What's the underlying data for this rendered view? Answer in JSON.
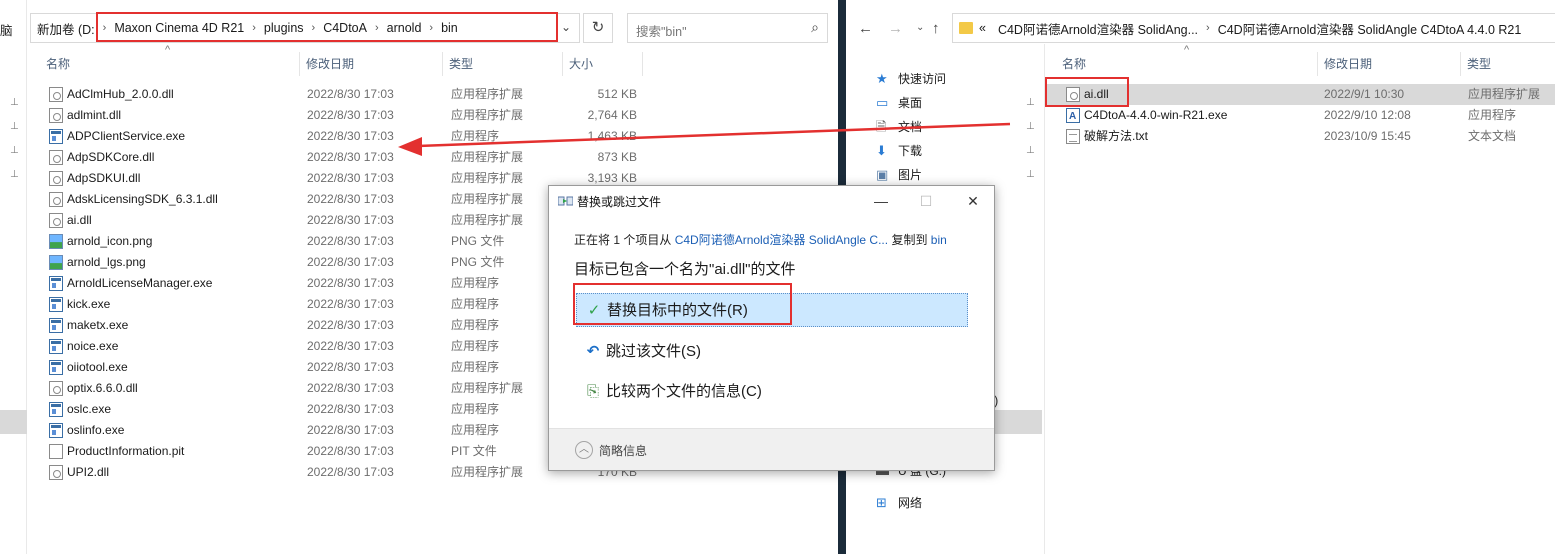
{
  "left": {
    "breadcrumb_prefix": "脑",
    "breadcrumb": [
      "新加卷 (D:",
      "Maxon Cinema 4D R21",
      "plugins",
      "C4DtoA",
      "arnold",
      "bin"
    ],
    "search_placeholder": "搜索\"bin\"",
    "columns": {
      "name": "名称",
      "date": "修改日期",
      "type": "类型",
      "size": "大小"
    },
    "files": [
      {
        "name": "AdClmHub_2.0.0.dll",
        "date": "2022/8/30 17:03",
        "type": "应用程序扩展",
        "size": "512 KB",
        "icon": "dll"
      },
      {
        "name": "adlmint.dll",
        "date": "2022/8/30 17:03",
        "type": "应用程序扩展",
        "size": "2,764 KB",
        "icon": "dll"
      },
      {
        "name": "ADPClientService.exe",
        "date": "2022/8/30 17:03",
        "type": "应用程序",
        "size": "1,463 KB",
        "icon": "exe"
      },
      {
        "name": "AdpSDKCore.dll",
        "date": "2022/8/30 17:03",
        "type": "应用程序扩展",
        "size": "873 KB",
        "icon": "dll"
      },
      {
        "name": "AdpSDKUI.dll",
        "date": "2022/8/30 17:03",
        "type": "应用程序扩展",
        "size": "3,193 KB",
        "icon": "dll"
      },
      {
        "name": "AdskLicensingSDK_6.3.1.dll",
        "date": "2022/8/30 17:03",
        "type": "应用程序扩展",
        "size": "",
        "icon": "dll"
      },
      {
        "name": "ai.dll",
        "date": "2022/8/30 17:03",
        "type": "应用程序扩展",
        "size": "",
        "icon": "dll"
      },
      {
        "name": "arnold_icon.png",
        "date": "2022/8/30 17:03",
        "type": "PNG 文件",
        "size": "",
        "icon": "png"
      },
      {
        "name": "arnold_lgs.png",
        "date": "2022/8/30 17:03",
        "type": "PNG 文件",
        "size": "",
        "icon": "png"
      },
      {
        "name": "ArnoldLicenseManager.exe",
        "date": "2022/8/30 17:03",
        "type": "应用程序",
        "size": "",
        "icon": "exe"
      },
      {
        "name": "kick.exe",
        "date": "2022/8/30 17:03",
        "type": "应用程序",
        "size": "",
        "icon": "exe"
      },
      {
        "name": "maketx.exe",
        "date": "2022/8/30 17:03",
        "type": "应用程序",
        "size": "",
        "icon": "exe"
      },
      {
        "name": "noice.exe",
        "date": "2022/8/30 17:03",
        "type": "应用程序",
        "size": "",
        "icon": "exe"
      },
      {
        "name": "oiiotool.exe",
        "date": "2022/8/30 17:03",
        "type": "应用程序",
        "size": "",
        "icon": "exe"
      },
      {
        "name": "optix.6.6.0.dll",
        "date": "2022/8/30 17:03",
        "type": "应用程序扩展",
        "size": "",
        "icon": "dll"
      },
      {
        "name": "oslc.exe",
        "date": "2022/8/30 17:03",
        "type": "应用程序",
        "size": "",
        "icon": "exe"
      },
      {
        "name": "oslinfo.exe",
        "date": "2022/8/30 17:03",
        "type": "应用程序",
        "size": "",
        "icon": "exe"
      },
      {
        "name": "ProductInformation.pit",
        "date": "2022/8/30 17:03",
        "type": "PIT 文件",
        "size": "",
        "icon": "pit"
      },
      {
        "name": "UPI2.dll",
        "date": "2022/8/30 17:03",
        "type": "应用程序扩展",
        "size": "170 KB",
        "icon": "dll"
      }
    ]
  },
  "right": {
    "breadcrumb_prefix": "«",
    "breadcrumb": [
      "C4D阿诺德Arnold渲染器 SolidAng...",
      "C4D阿诺德Arnold渲染器 SolidAngle C4DtoA 4.4.0 R21"
    ],
    "columns": {
      "name": "名称",
      "date": "修改日期",
      "type": "类型"
    },
    "nav": [
      {
        "label": "快速访问",
        "icon": "star-icon"
      },
      {
        "label": "桌面",
        "icon": "desktop-icon"
      },
      {
        "label": "文档",
        "icon": "document-icon"
      },
      {
        "label": "下载",
        "icon": "download-icon"
      },
      {
        "label": "图片",
        "icon": "pictures-icon"
      }
    ],
    "nav_bottom": [
      {
        "label": "U 盘 (G:)",
        "icon": "usb-drive-icon"
      },
      {
        "label": "网络",
        "icon": "network-icon"
      }
    ],
    "files": [
      {
        "name": "ai.dll",
        "date": "2022/9/1 10:30",
        "type": "应用程序扩展",
        "icon": "dll"
      },
      {
        "name": "C4DtoA-4.4.0-win-R21.exe",
        "date": "2022/9/10 12:08",
        "type": "应用程序",
        "icon": "c4d"
      },
      {
        "name": "破解方法.txt",
        "date": "2023/10/9 15:45",
        "type": "文本文档",
        "icon": "txt"
      }
    ]
  },
  "dialog": {
    "title": "替换或跳过文件",
    "line1_pre": "正在将 1 个项目从",
    "line1_source": "C4D阿诺德Arnold渲染器 SolidAngle C...",
    "line1_mid": "复制到",
    "line1_dest": "bin",
    "line2": "目标已包含一个名为\"ai.dll\"的文件",
    "options": [
      {
        "label": "替换目标中的文件(R)",
        "icon": "✓"
      },
      {
        "label": "跳过该文件(S)",
        "icon": "↶"
      },
      {
        "label": "比较两个文件的信息(C)",
        "icon": "⎘"
      }
    ],
    "footer": "简略信息"
  }
}
